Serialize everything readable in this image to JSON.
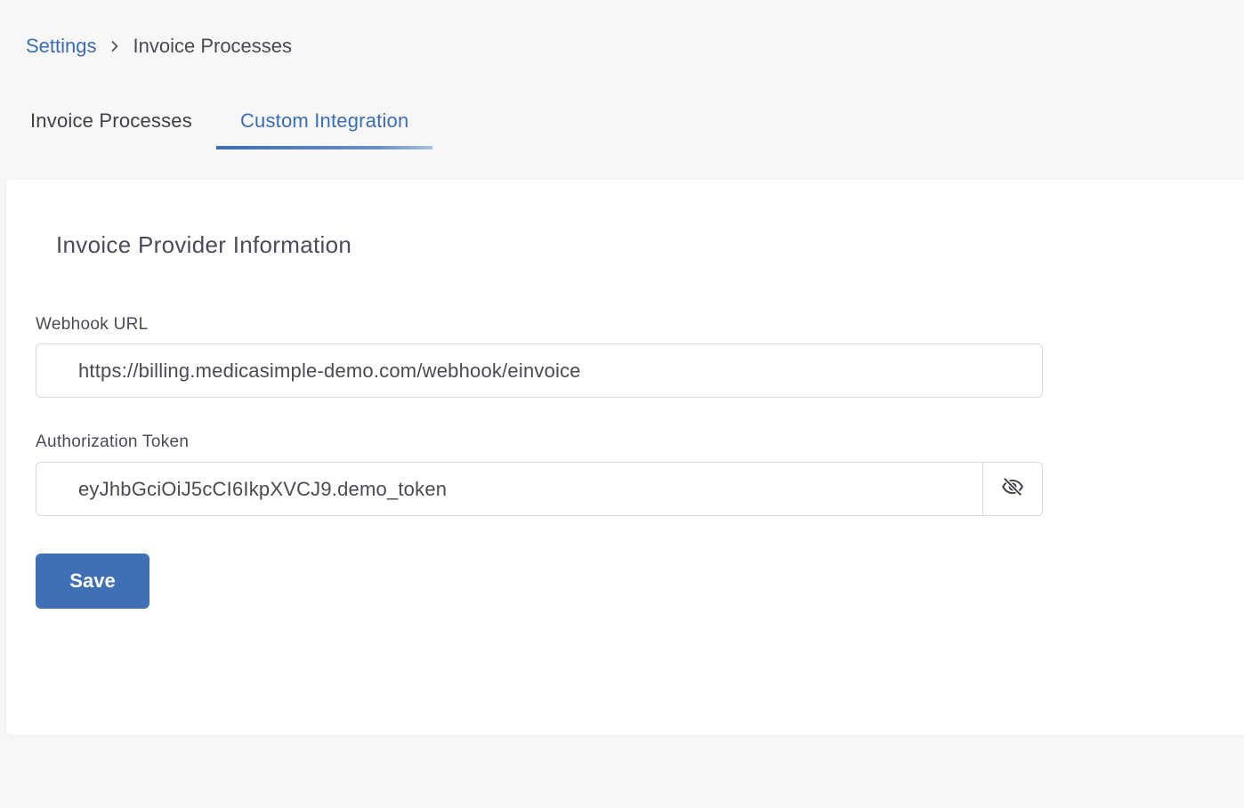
{
  "breadcrumb": {
    "parent": "Settings",
    "current": "Invoice Processes",
    "separator_icon": "chevron-right-icon"
  },
  "tabs": [
    {
      "label": "Invoice Processes",
      "active": false
    },
    {
      "label": "Custom Integration",
      "active": true
    }
  ],
  "card": {
    "title": "Invoice Provider Information",
    "webhook": {
      "label": "Webhook URL",
      "value": "https://billing.medicasimple-demo.com/webhook/einvoice"
    },
    "token": {
      "label": "Authorization Token",
      "value": "eyJhbGciOiJ5cCI6IkpXVCJ9.demo_token",
      "toggle_icon": "eye-off-icon"
    },
    "save_label": "Save"
  },
  "colors": {
    "accent": "#3b6db5",
    "button": "#3f6fb4",
    "background": "#f7f7f7",
    "card": "#ffffff"
  }
}
